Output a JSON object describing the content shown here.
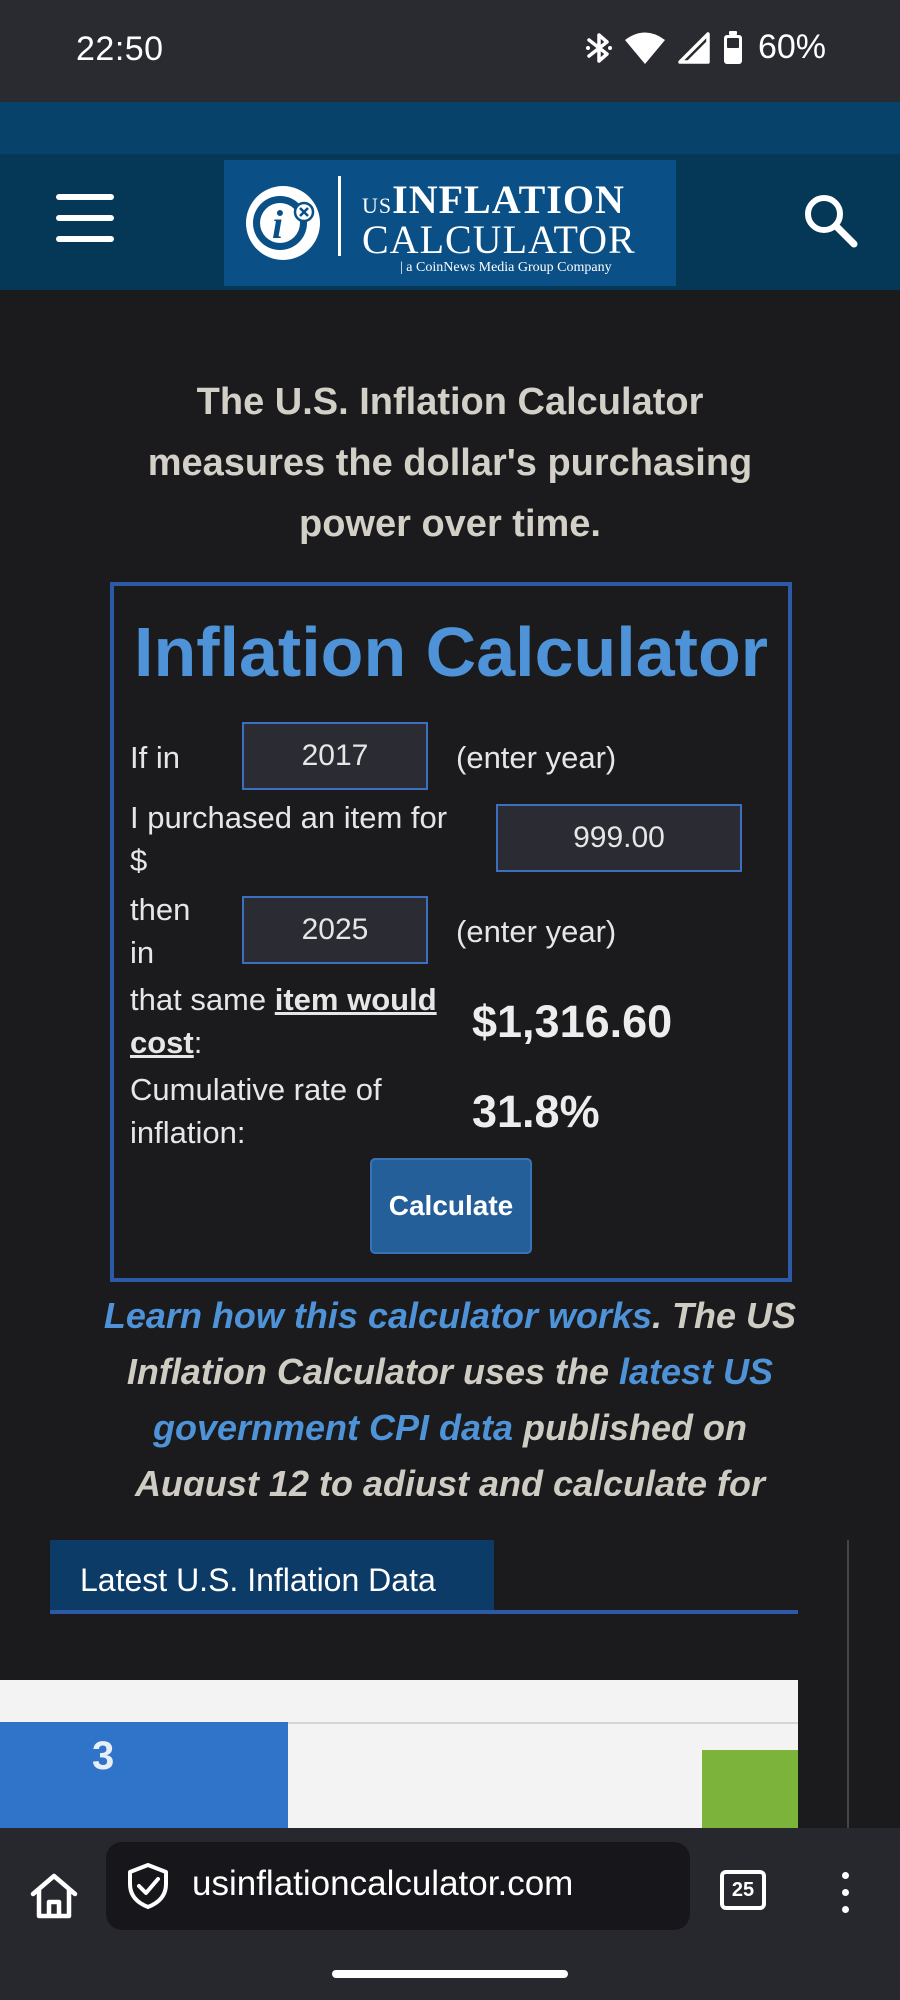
{
  "status_bar": {
    "time": "22:50",
    "battery": "60%",
    "icons": [
      "bluetooth-icon",
      "wifi-icon",
      "signal-icon",
      "battery-icon"
    ]
  },
  "header": {
    "logo": {
      "prefix": "US",
      "line1": "INFLATION",
      "line2": "CALCULATOR",
      "tagline": "| a CoinNews Media Group Company"
    },
    "icons": [
      "hamburger-menu-icon",
      "search-icon"
    ]
  },
  "intro": {
    "text": "The U.S. Inflation Calculator measures the dollar's purchasing power over time."
  },
  "calculator": {
    "title": "Inflation Calculator",
    "row1_label": "If in",
    "start_year": "2017",
    "enter_year_hint_1": "(enter year)",
    "row2_label": "I purchased an item for $",
    "amount": "999.00",
    "row3_label": "then in",
    "end_year": "2025",
    "enter_year_hint_2": "(enter year)",
    "row4_prefix": "that same ",
    "row4_link": "item would cost",
    "row4_suffix": ":",
    "result_value": "$1,316.60",
    "row5_label": "Cumulative rate of inflation:",
    "rate_value": "31.8%",
    "button": "Calculate"
  },
  "learn": {
    "link1": "Learn how this calculator works",
    "text1": ". The US Inflation Calculator uses the ",
    "link2": "latest US government CPI data",
    "text2": " published on August 12 to adjust and calculate for"
  },
  "latest": {
    "tab_label": "Latest U.S. Inflation Data",
    "chart_visible_label": "3"
  },
  "browser": {
    "url": "usinflationcalculator.com",
    "tab_count": "25",
    "icons": [
      "home-icon",
      "shield-icon",
      "tabs-icon",
      "more-vert-icon"
    ]
  },
  "colors": {
    "page_bg": "#1b1b1d",
    "header_bg": "#053757",
    "accent_blue": "#4e93d8",
    "calc_border": "#2c5aa6",
    "button_bg": "#245f9a"
  }
}
